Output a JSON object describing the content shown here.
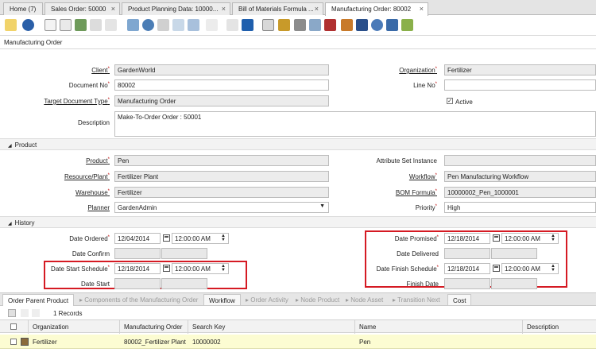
{
  "tabs": [
    {
      "label": "Home (7)",
      "closable": false
    },
    {
      "label": "Sales Order: 50000",
      "closable": true
    },
    {
      "label": "Product Planning Data: 10000...",
      "closable": true
    },
    {
      "label": "Bill of Materials Formula ...",
      "closable": true
    },
    {
      "label": "Manufacturing Order: 80002",
      "closable": true
    }
  ],
  "close_glyph": "×",
  "window_title": "Manufacturing Order",
  "fields": {
    "client_label": "Client",
    "client_value": "GardenWorld",
    "organization_label": "Organization",
    "organization_value": "Fertilizer",
    "document_no_label": "Document No",
    "document_no_value": "80002",
    "line_no_label": "Line No",
    "target_doc_type_label": "Target Document Type",
    "target_doc_type_value": "Manufacturing Order",
    "active_label": "Active",
    "description_label": "Description",
    "description_value": "Make-To-Order Order : 50001"
  },
  "product_section": {
    "title": "Product",
    "product_label": "Product",
    "product_value": "Pen",
    "attribute_set_label": "Attribute Set Instance",
    "resource_label": "Resource/Plant",
    "resource_value": "Fertilizer Plant",
    "workflow_label": "Workflow",
    "workflow_value": "Pen Manufacturing Workflow",
    "warehouse_label": "Warehouse",
    "warehouse_value": "Fertilizer",
    "bom_label": "BOM Formula",
    "bom_value": "10000002_Pen_1000001",
    "planner_label": "Planner",
    "planner_value": "GardenAdmin",
    "priority_label": "Priority",
    "priority_value": "High"
  },
  "history_section": {
    "title": "History",
    "date_ordered_label": "Date Ordered",
    "date_ordered_date": "12/04/2014",
    "date_ordered_time": "12:00:00 AM",
    "date_promised_label": "Date Promised",
    "date_promised_date": "12/18/2014",
    "date_promised_time": "12:00:00 AM",
    "date_confirm_label": "Date Confirm",
    "date_delivered_label": "Date Delivered",
    "date_start_schedule_label": "Date Start Schedule",
    "date_start_schedule_date": "12/18/2014",
    "date_start_schedule_time": "12:00:00 AM",
    "date_finish_schedule_label": "Date Finish Schedule",
    "date_finish_schedule_date": "12/18/2014",
    "date_finish_schedule_time": "12:00:00 AM",
    "date_start_label": "Date Start",
    "finish_date_label": "Finish Date"
  },
  "detail_tabs": [
    {
      "label": "Order Parent Product",
      "state": "active"
    },
    {
      "label": "Components of the Manufacturing Order",
      "state": "disabled"
    },
    {
      "label": "Workflow",
      "state": "boxed"
    },
    {
      "label": "Order Activity",
      "state": "disabled"
    },
    {
      "label": "Node Product",
      "state": "disabled"
    },
    {
      "label": "Node Asset",
      "state": "disabled"
    },
    {
      "label": "Transition Next",
      "state": "disabled"
    },
    {
      "label": "Cost",
      "state": "boxed"
    }
  ],
  "grid": {
    "records_label": "1 Records",
    "columns": [
      "Organization",
      "Manufacturing Order",
      "Search Key",
      "Name",
      "Description"
    ],
    "rows": [
      [
        "Fertilizer",
        "80002_Fertilizer Plant",
        "10000002",
        "Pen",
        ""
      ]
    ]
  },
  "colors": {
    "highlight_box": "#d51a23",
    "selected_row": "#fcfcd2"
  }
}
